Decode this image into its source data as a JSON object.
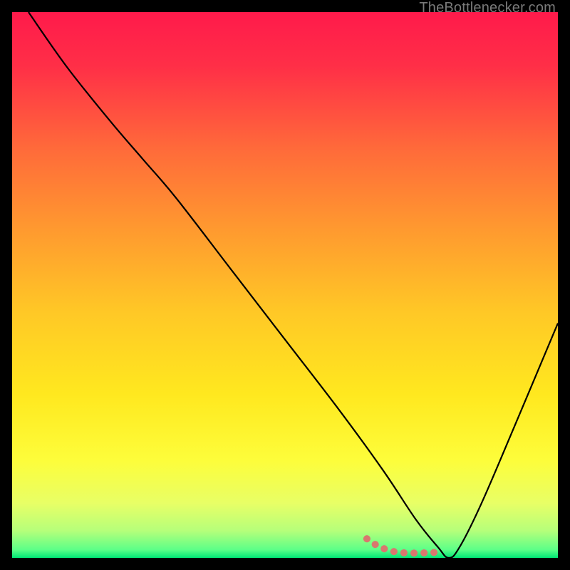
{
  "watermark": "TheBottlenecker.com",
  "chart_data": {
    "type": "line",
    "title": "",
    "xlabel": "",
    "ylabel": "",
    "xlim": [
      0,
      100
    ],
    "ylim": [
      0,
      100
    ],
    "gradient_stops": [
      {
        "offset": 0.0,
        "color": "#ff1a4b"
      },
      {
        "offset": 0.1,
        "color": "#ff2f47"
      },
      {
        "offset": 0.25,
        "color": "#ff6a3a"
      },
      {
        "offset": 0.4,
        "color": "#ff9a2f"
      },
      {
        "offset": 0.55,
        "color": "#ffc826"
      },
      {
        "offset": 0.7,
        "color": "#ffe81f"
      },
      {
        "offset": 0.82,
        "color": "#fdfd3a"
      },
      {
        "offset": 0.9,
        "color": "#e8ff66"
      },
      {
        "offset": 0.95,
        "color": "#b6ff7a"
      },
      {
        "offset": 0.985,
        "color": "#5cff88"
      },
      {
        "offset": 1.0,
        "color": "#00e676"
      }
    ],
    "series": [
      {
        "name": "bottleneck-curve",
        "stroke": "#000000",
        "stroke_width": 2.2,
        "x": [
          3,
          10,
          18,
          24,
          30,
          40,
          50,
          60,
          68,
          74,
          78,
          80,
          82,
          86,
          92,
          100
        ],
        "y": [
          100,
          90,
          80,
          73,
          66,
          53,
          40,
          27,
          16,
          7,
          2,
          0,
          2,
          10,
          24,
          43
        ]
      },
      {
        "name": "optimal-range-marker",
        "stroke": "#d9776e",
        "stroke_width": 10,
        "linecap": "round",
        "dash": "0.1 14",
        "x": [
          65,
          67,
          69,
          71,
          73,
          75,
          77,
          79
        ],
        "y": [
          3.5,
          2.2,
          1.4,
          1.0,
          0.9,
          0.9,
          1.0,
          0.9
        ]
      }
    ]
  }
}
